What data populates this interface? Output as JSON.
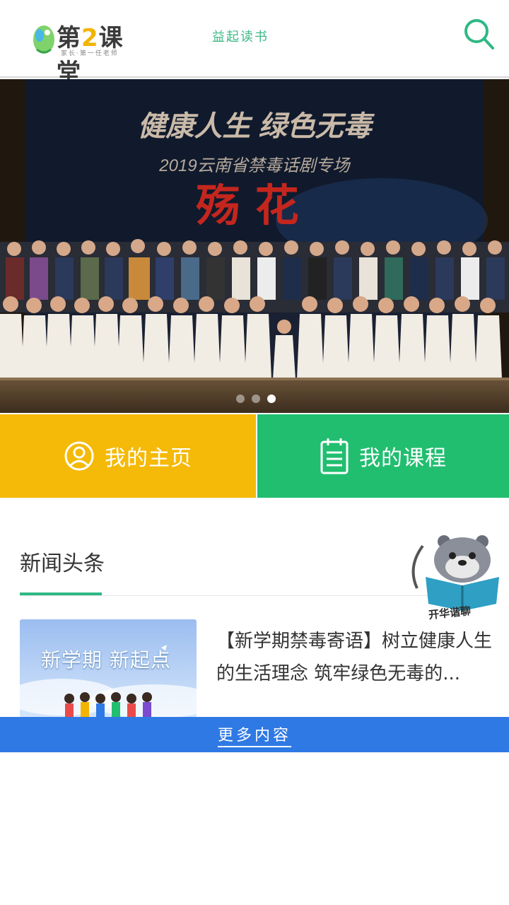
{
  "header": {
    "logo": {
      "title_prefix": "第",
      "title_digit": "2",
      "title_suffix": "课堂",
      "subtitle": "家长·第一任老师"
    },
    "center_text": "益起读书",
    "search_icon": "search-icon"
  },
  "banner": {
    "headline": "健康人生  绿色无毒",
    "subline": "2019云南省禁毒话剧专场",
    "play_title": "殇 花",
    "dots": 3,
    "active_dot": 3
  },
  "tiles": {
    "home": {
      "label": "我的主页",
      "icon": "user-icon",
      "color": "#f5b907"
    },
    "course": {
      "label": "我的课程",
      "icon": "clipboard-icon",
      "color": "#21be70"
    }
  },
  "news": {
    "section_title": "新闻头条",
    "mascot_label": "开华谐聊",
    "items": [
      {
        "thumb_text": "新学期 新起点",
        "title": "【新学期禁毒寄语】树立健康人生的生活理念 筑牢绿色无毒的..."
      }
    ]
  },
  "more": {
    "label": "更多内容",
    "color": "#2f79e4"
  }
}
